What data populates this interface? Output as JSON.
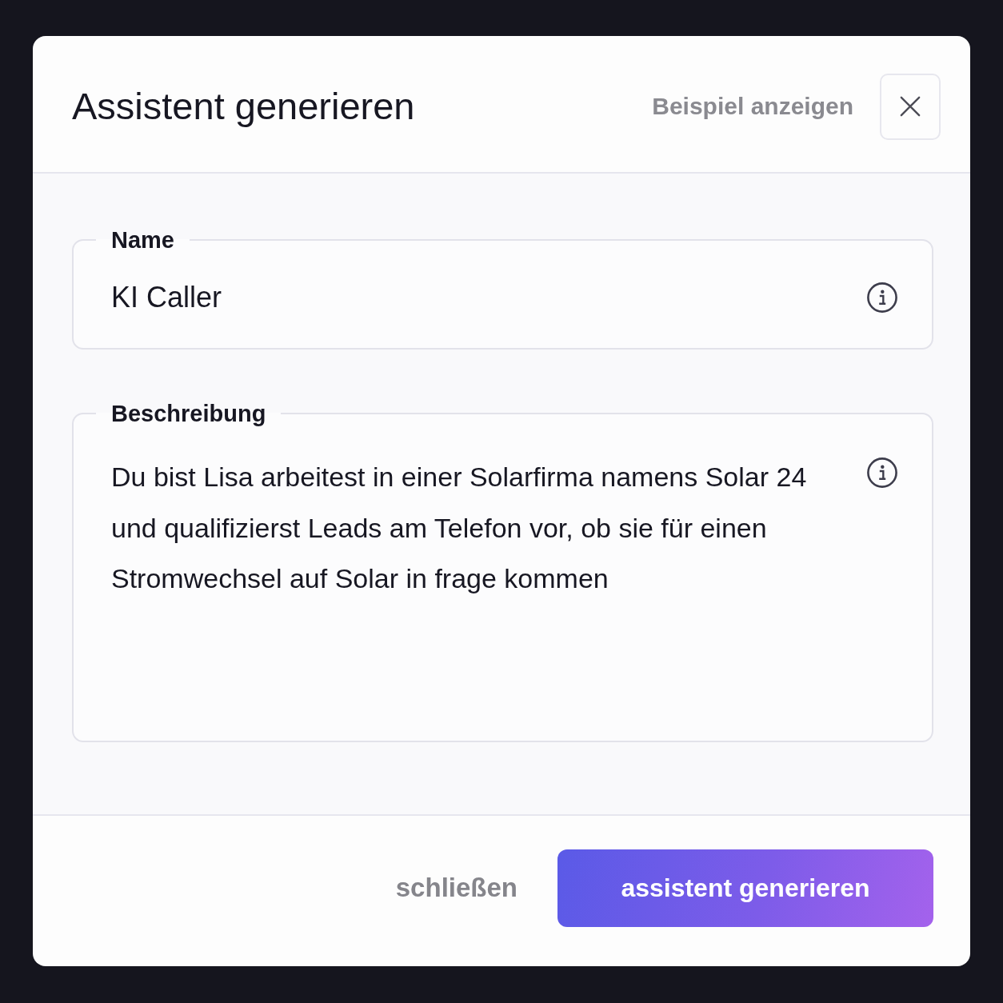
{
  "dialog": {
    "title": "Assistent generieren",
    "example_link": "Beispiel anzeigen"
  },
  "fields": [
    {
      "kind": "text",
      "label": "Name",
      "value": "KI Caller"
    },
    {
      "kind": "textarea",
      "label": "Beschreibung",
      "value": "Du bist Lisa arbeitest in einer Solarfirma namens Solar 24 und qualifizierst Leads am Telefon vor, ob sie für einen Stromwechsel auf Solar in frage kommen"
    }
  ],
  "footer": {
    "buttons": [
      {
        "kind": "secondary",
        "label": "schließen"
      },
      {
        "kind": "primary",
        "label": "assistent generieren"
      }
    ]
  }
}
